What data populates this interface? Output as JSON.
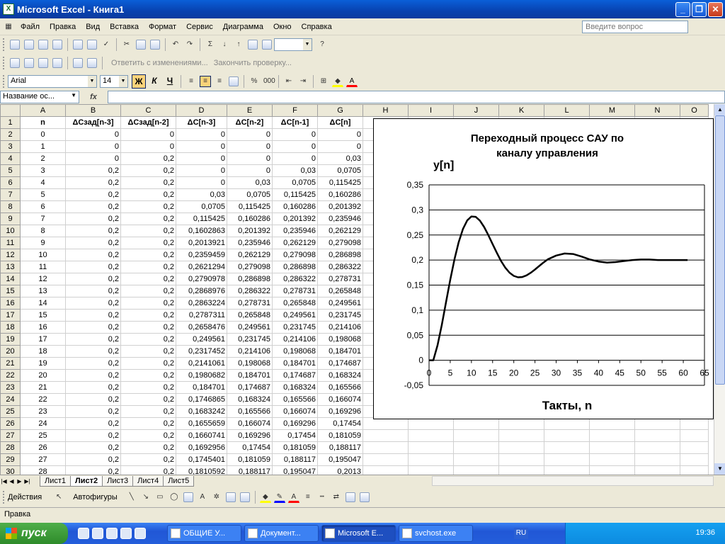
{
  "window": {
    "title": "Microsoft Excel - Книга1"
  },
  "menu": [
    "Файл",
    "Правка",
    "Вид",
    "Вставка",
    "Формат",
    "Сервис",
    "Диаграмма",
    "Окно",
    "Справка"
  ],
  "ask_placeholder": "Введите вопрос",
  "review_bar": {
    "reply": "Ответить с изменениями...",
    "finish": "Закончить проверку..."
  },
  "format_bar": {
    "font": "Arial",
    "size": "14",
    "bold": "Ж",
    "italic": "К",
    "underline": "Ч"
  },
  "formula_bar": {
    "name_box": "Название ос...",
    "fx": "fx"
  },
  "columns": [
    "A",
    "B",
    "C",
    "D",
    "E",
    "F",
    "G",
    "H",
    "I",
    "J",
    "K",
    "L",
    "M",
    "N",
    "O"
  ],
  "headers": [
    "n",
    "ΔСзад[n-3]",
    "ΔСзад[n-2]",
    "ΔС[n-3]",
    "ΔС[n-2]",
    "ΔС[n-1]",
    "ΔС[n]"
  ],
  "rows": [
    [
      "0",
      "0",
      "0",
      "0",
      "0",
      "0",
      "0"
    ],
    [
      "1",
      "0",
      "0",
      "0",
      "0",
      "0",
      "0"
    ],
    [
      "2",
      "0",
      "0,2",
      "0",
      "0",
      "0",
      "0,03"
    ],
    [
      "3",
      "0,2",
      "0,2",
      "0",
      "0",
      "0,03",
      "0,0705"
    ],
    [
      "4",
      "0,2",
      "0,2",
      "0",
      "0,03",
      "0,0705",
      "0,115425"
    ],
    [
      "5",
      "0,2",
      "0,2",
      "0,03",
      "0,0705",
      "0,115425",
      "0,160286"
    ],
    [
      "6",
      "0,2",
      "0,2",
      "0,0705",
      "0,115425",
      "0,160286",
      "0,201392"
    ],
    [
      "7",
      "0,2",
      "0,2",
      "0,115425",
      "0,160286",
      "0,201392",
      "0,235946"
    ],
    [
      "8",
      "0,2",
      "0,2",
      "0,1602863",
      "0,201392",
      "0,235946",
      "0,262129"
    ],
    [
      "9",
      "0,2",
      "0,2",
      "0,2013921",
      "0,235946",
      "0,262129",
      "0,279098"
    ],
    [
      "10",
      "0,2",
      "0,2",
      "0,2359459",
      "0,262129",
      "0,279098",
      "0,286898"
    ],
    [
      "11",
      "0,2",
      "0,2",
      "0,2621294",
      "0,279098",
      "0,286898",
      "0,286322"
    ],
    [
      "12",
      "0,2",
      "0,2",
      "0,2790978",
      "0,286898",
      "0,286322",
      "0,278731"
    ],
    [
      "13",
      "0,2",
      "0,2",
      "0,2868976",
      "0,286322",
      "0,278731",
      "0,265848"
    ],
    [
      "14",
      "0,2",
      "0,2",
      "0,2863224",
      "0,278731",
      "0,265848",
      "0,249561"
    ],
    [
      "15",
      "0,2",
      "0,2",
      "0,2787311",
      "0,265848",
      "0,249561",
      "0,231745"
    ],
    [
      "16",
      "0,2",
      "0,2",
      "0,2658476",
      "0,249561",
      "0,231745",
      "0,214106"
    ],
    [
      "17",
      "0,2",
      "0,2",
      "0,249561",
      "0,231745",
      "0,214106",
      "0,198068"
    ],
    [
      "18",
      "0,2",
      "0,2",
      "0,2317452",
      "0,214106",
      "0,198068",
      "0,184701"
    ],
    [
      "19",
      "0,2",
      "0,2",
      "0,2141061",
      "0,198068",
      "0,184701",
      "0,174687"
    ],
    [
      "20",
      "0,2",
      "0,2",
      "0,1980682",
      "0,184701",
      "0,174687",
      "0,168324"
    ],
    [
      "21",
      "0,2",
      "0,2",
      "0,184701",
      "0,174687",
      "0,168324",
      "0,165566"
    ],
    [
      "22",
      "0,2",
      "0,2",
      "0,1746865",
      "0,168324",
      "0,165566",
      "0,166074"
    ],
    [
      "23",
      "0,2",
      "0,2",
      "0,1683242",
      "0,165566",
      "0,166074",
      "0,169296"
    ],
    [
      "24",
      "0,2",
      "0,2",
      "0,1655659",
      "0,166074",
      "0,169296",
      "0,17454"
    ],
    [
      "25",
      "0,2",
      "0,2",
      "0,1660741",
      "0,169296",
      "0,17454",
      "0,181059"
    ],
    [
      "26",
      "0,2",
      "0,2",
      "0,1692956",
      "0,17454",
      "0,181059",
      "0,188117"
    ],
    [
      "27",
      "0,2",
      "0,2",
      "0,1745401",
      "0,181059",
      "0,188117",
      "0,195047"
    ],
    [
      "28",
      "0,2",
      "0,2",
      "0,1810592",
      "0,188117",
      "0,195047",
      "0,2013"
    ]
  ],
  "sheets": [
    "Лист1",
    "Лист2",
    "Лист3",
    "Лист4",
    "Лист5"
  ],
  "active_sheet": "Лист2",
  "draw_bar": {
    "actions": "Действия",
    "autoshapes": "Автофигуры"
  },
  "status": "Правка",
  "taskbar": {
    "start": "пуск",
    "tasks": [
      "ОБЩИЕ У...",
      "Документ...",
      "Microsoft E...",
      "svchost.exe"
    ],
    "lang": "RU",
    "clock": "19:36"
  },
  "chart_data": {
    "type": "line",
    "title": "Переходный процесс САУ по каналу управления",
    "ylabel": "y[n]",
    "xlabel": "Такты, n",
    "xlim": [
      0,
      65
    ],
    "ylim": [
      -0.05,
      0.35
    ],
    "xticks": [
      "0",
      "5",
      "10",
      "15",
      "20",
      "25",
      "30",
      "35",
      "40",
      "45",
      "50",
      "55",
      "60",
      "65"
    ],
    "yticks": [
      "0,35",
      "0,3",
      "0,25",
      "0,2",
      "0,15",
      "0,1",
      "0,05",
      "0",
      "-0,05"
    ],
    "grid": true,
    "x": [
      0,
      1,
      2,
      3,
      4,
      5,
      6,
      7,
      8,
      9,
      10,
      11,
      12,
      13,
      14,
      15,
      16,
      17,
      18,
      19,
      20,
      21,
      22,
      23,
      24,
      25,
      26,
      27,
      28,
      30,
      32,
      34,
      36,
      38,
      40,
      42,
      44,
      46,
      48,
      50,
      52,
      54,
      56,
      58,
      60,
      61
    ],
    "y": [
      0,
      0,
      0.03,
      0.0705,
      0.115425,
      0.160286,
      0.201392,
      0.235946,
      0.262129,
      0.279098,
      0.286898,
      0.286322,
      0.278731,
      0.265848,
      0.249561,
      0.231745,
      0.214106,
      0.198068,
      0.184701,
      0.174687,
      0.168324,
      0.165566,
      0.166074,
      0.169296,
      0.17454,
      0.181059,
      0.188117,
      0.195047,
      0.2013,
      0.209,
      0.213,
      0.212,
      0.207,
      0.201,
      0.197,
      0.195,
      0.196,
      0.198,
      0.2,
      0.201,
      0.201,
      0.2,
      0.2,
      0.2,
      0.2,
      0.2
    ],
    "series_color": "#000000"
  }
}
